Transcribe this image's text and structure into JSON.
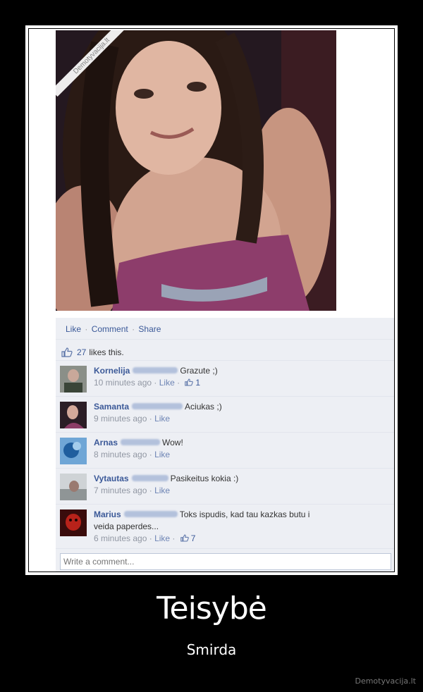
{
  "watermark": "Demotyvacija.lt",
  "post": {
    "actions": [
      "Like",
      "Comment",
      "Share"
    ],
    "likes_count": "27",
    "likes_suffix": "likes this."
  },
  "comments": [
    {
      "name": "Kornelija",
      "text": "Grazute ;)",
      "time": "10 minutes ago",
      "like": "Like",
      "likes": "1"
    },
    {
      "name": "Samanta",
      "text": "Aciukas ;)",
      "time": "9 minutes ago",
      "like": "Like",
      "likes": ""
    },
    {
      "name": "Arnas",
      "text": "Wow!",
      "time": "8 minutes ago",
      "like": "Like",
      "likes": ""
    },
    {
      "name": "Vytautas",
      "text": "Pasikeitus kokia :)",
      "time": "7 minutes ago",
      "like": "Like",
      "likes": ""
    },
    {
      "name": "Marius",
      "text": "Toks ispudis, kad tau kazkas butu i",
      "text2": "veida paperdes...",
      "time": "6 minutes ago",
      "like": "Like",
      "likes": "7"
    }
  ],
  "write_placeholder": "Write a comment...",
  "poster": {
    "title": "Teisybė",
    "subtitle": "Smirda",
    "site": "Demotyvacija.lt"
  },
  "colors": {
    "fb_link": "#3b5998",
    "fb_bg": "#edeff4",
    "poster_bg": "#000000"
  }
}
